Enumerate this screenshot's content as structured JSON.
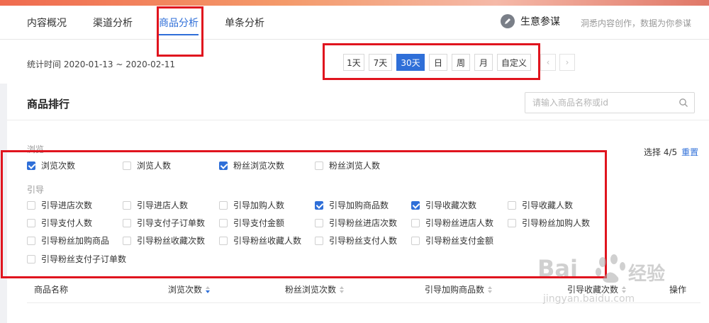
{
  "tabs": [
    {
      "label": "内容概况",
      "active": false
    },
    {
      "label": "渠道分析",
      "active": false
    },
    {
      "label": "商品分析",
      "active": true
    },
    {
      "label": "单条分析",
      "active": false
    }
  ],
  "advisor": {
    "label": "生意参谋",
    "tagline": "洞悉内容创作，数据为你参谋"
  },
  "date_bar": {
    "stat_time": "统计时间 2020-01-13 ~ 2020-02-11",
    "buttons": [
      {
        "label": "1天",
        "active": false
      },
      {
        "label": "7天",
        "active": false
      },
      {
        "label": "30天",
        "active": true
      },
      {
        "label": "日",
        "active": false
      },
      {
        "label": "周",
        "active": false
      },
      {
        "label": "月",
        "active": false
      },
      {
        "label": "自定义",
        "active": false
      }
    ],
    "prev_icon": "chevron-left-icon",
    "next_icon": "chevron-right-icon"
  },
  "ranking": {
    "title": "商品排行",
    "search_placeholder": "请输入商品名称或id",
    "select_info": "选择 4/5",
    "reset_label": "重置",
    "groups": [
      {
        "label": "浏览",
        "items": [
          {
            "label": "浏览次数",
            "checked": true
          },
          {
            "label": "浏览人数",
            "checked": false
          },
          {
            "label": "粉丝浏览次数",
            "checked": true
          },
          {
            "label": "粉丝浏览人数",
            "checked": false
          }
        ]
      },
      {
        "label": "引导",
        "items": [
          {
            "label": "引导进店次数",
            "checked": false
          },
          {
            "label": "引导进店人数",
            "checked": false
          },
          {
            "label": "引导加购人数",
            "checked": false
          },
          {
            "label": "引导加购商品数",
            "checked": true
          },
          {
            "label": "引导收藏次数",
            "checked": true
          },
          {
            "label": "引导收藏人数",
            "checked": false
          },
          {
            "label": "引导支付人数",
            "checked": false
          },
          {
            "label": "引导支付子订单数",
            "checked": false
          },
          {
            "label": "引导支付金额",
            "checked": false
          },
          {
            "label": "引导粉丝进店次数",
            "checked": false
          },
          {
            "label": "引导粉丝进店人数",
            "checked": false
          },
          {
            "label": "引导粉丝加购人数",
            "checked": false
          },
          {
            "label": "引导粉丝加购商品",
            "checked": false
          },
          {
            "label": "引导粉丝收藏次数",
            "checked": false
          },
          {
            "label": "引导粉丝收藏人数",
            "checked": false
          },
          {
            "label": "引导粉丝支付人数",
            "checked": false
          },
          {
            "label": "引导粉丝支付金额",
            "checked": false
          },
          {
            "label": "引导粉丝支付子订单数",
            "checked": false
          }
        ]
      }
    ],
    "columns": [
      {
        "label": "商品名称",
        "sortable": false
      },
      {
        "label": "浏览次数",
        "sortable": true,
        "sort": "desc"
      },
      {
        "label": "粉丝浏览次数",
        "sortable": true,
        "sort": "none"
      },
      {
        "label": "引导加购商品数",
        "sortable": true,
        "sort": "none"
      },
      {
        "label": "引导收藏次数",
        "sortable": true,
        "sort": "none"
      },
      {
        "label": "操作",
        "sortable": false
      }
    ]
  },
  "watermark": {
    "brand": "Bai",
    "brand_cn": "经验",
    "url": "jingyan.baidu.com"
  },
  "colors": {
    "accent": "#2f6fd8",
    "highlight": "#e0141e"
  }
}
